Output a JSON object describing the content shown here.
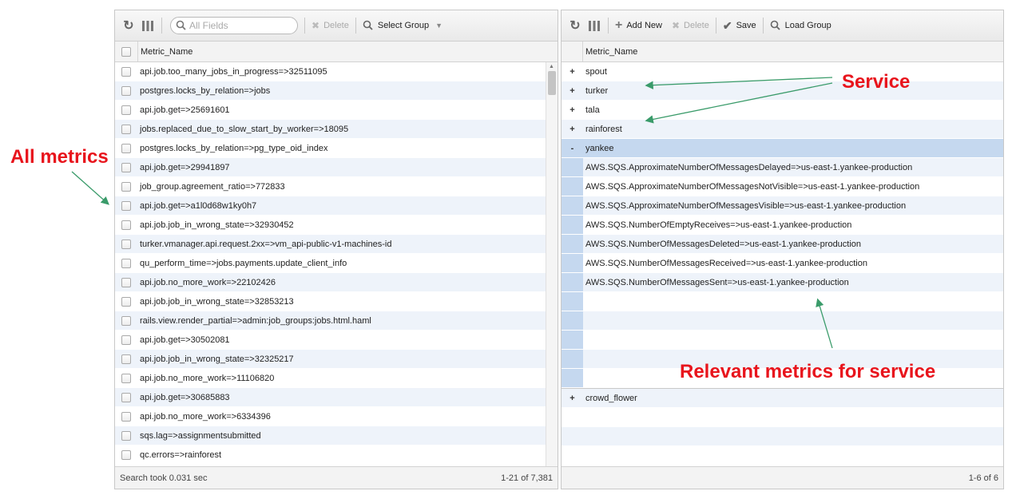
{
  "left": {
    "search_placeholder": "All Fields",
    "delete_label": "Delete",
    "select_group_label": "Select Group",
    "column_header": "Metric_Name",
    "rows": [
      "api.job.too_many_jobs_in_progress=>32511095",
      "postgres.locks_by_relation=>jobs",
      "api.job.get=>25691601",
      "jobs.replaced_due_to_slow_start_by_worker=>18095",
      "postgres.locks_by_relation=>pg_type_oid_index",
      "api.job.get=>29941897",
      "job_group.agreement_ratio=>772833",
      "api.job.get=>a1l0d68w1ky0h7",
      "api.job.job_in_wrong_state=>32930452",
      "turker.vmanager.api.request.2xx=>vm_api-public-v1-machines-id",
      "qu_perform_time=>jobs.payments.update_client_info",
      "api.job.no_more_work=>22102426",
      "api.job.job_in_wrong_state=>32853213",
      "rails.view.render_partial=>admin:job_groups:jobs.html.haml",
      "api.job.get=>30502081",
      "api.job.job_in_wrong_state=>32325217",
      "api.job.no_more_work=>11106820",
      "api.job.get=>30685883",
      "api.job.no_more_work=>6334396",
      "sqs.lag=>assignmentsubmitted",
      "qc.errors=>rainforest"
    ],
    "status": "Search took 0.031 sec",
    "count": "1-21 of 7,381"
  },
  "right": {
    "add_new_label": "Add New",
    "delete_label": "Delete",
    "save_label": "Save",
    "load_group_label": "Load Group",
    "column_header": "Metric_Name",
    "groups_before": [
      {
        "toggle": "+",
        "name": "spout"
      },
      {
        "toggle": "+",
        "name": "turker"
      },
      {
        "toggle": "+",
        "name": "tala"
      },
      {
        "toggle": "+",
        "name": "rainforest"
      }
    ],
    "expanded_group": {
      "toggle": "-",
      "name": "yankee"
    },
    "expanded_children": [
      "AWS.SQS.ApproximateNumberOfMessagesDelayed=>us-east-1.yankee-production",
      "AWS.SQS.ApproximateNumberOfMessagesNotVisible=>us-east-1.yankee-production",
      "AWS.SQS.ApproximateNumberOfMessagesVisible=>us-east-1.yankee-production",
      "AWS.SQS.NumberOfEmptyReceives=>us-east-1.yankee-production",
      "AWS.SQS.NumberOfMessagesDeleted=>us-east-1.yankee-production",
      "AWS.SQS.NumberOfMessagesReceived=>us-east-1.yankee-production",
      "AWS.SQS.NumberOfMessagesSent=>us-east-1.yankee-production"
    ],
    "groups_after": [
      {
        "toggle": "+",
        "name": "crowd_flower"
      }
    ],
    "count": "1-6 of 6"
  },
  "annotations": {
    "all_metrics": "All metrics",
    "service": "Service",
    "relevant": "Relevant metrics for service"
  },
  "colors": {
    "annotation_text": "#e8141c",
    "annotation_arrow": "#3a9b6a",
    "selected_row": "#c5d8ef",
    "alt_row": "#eef3fa"
  }
}
